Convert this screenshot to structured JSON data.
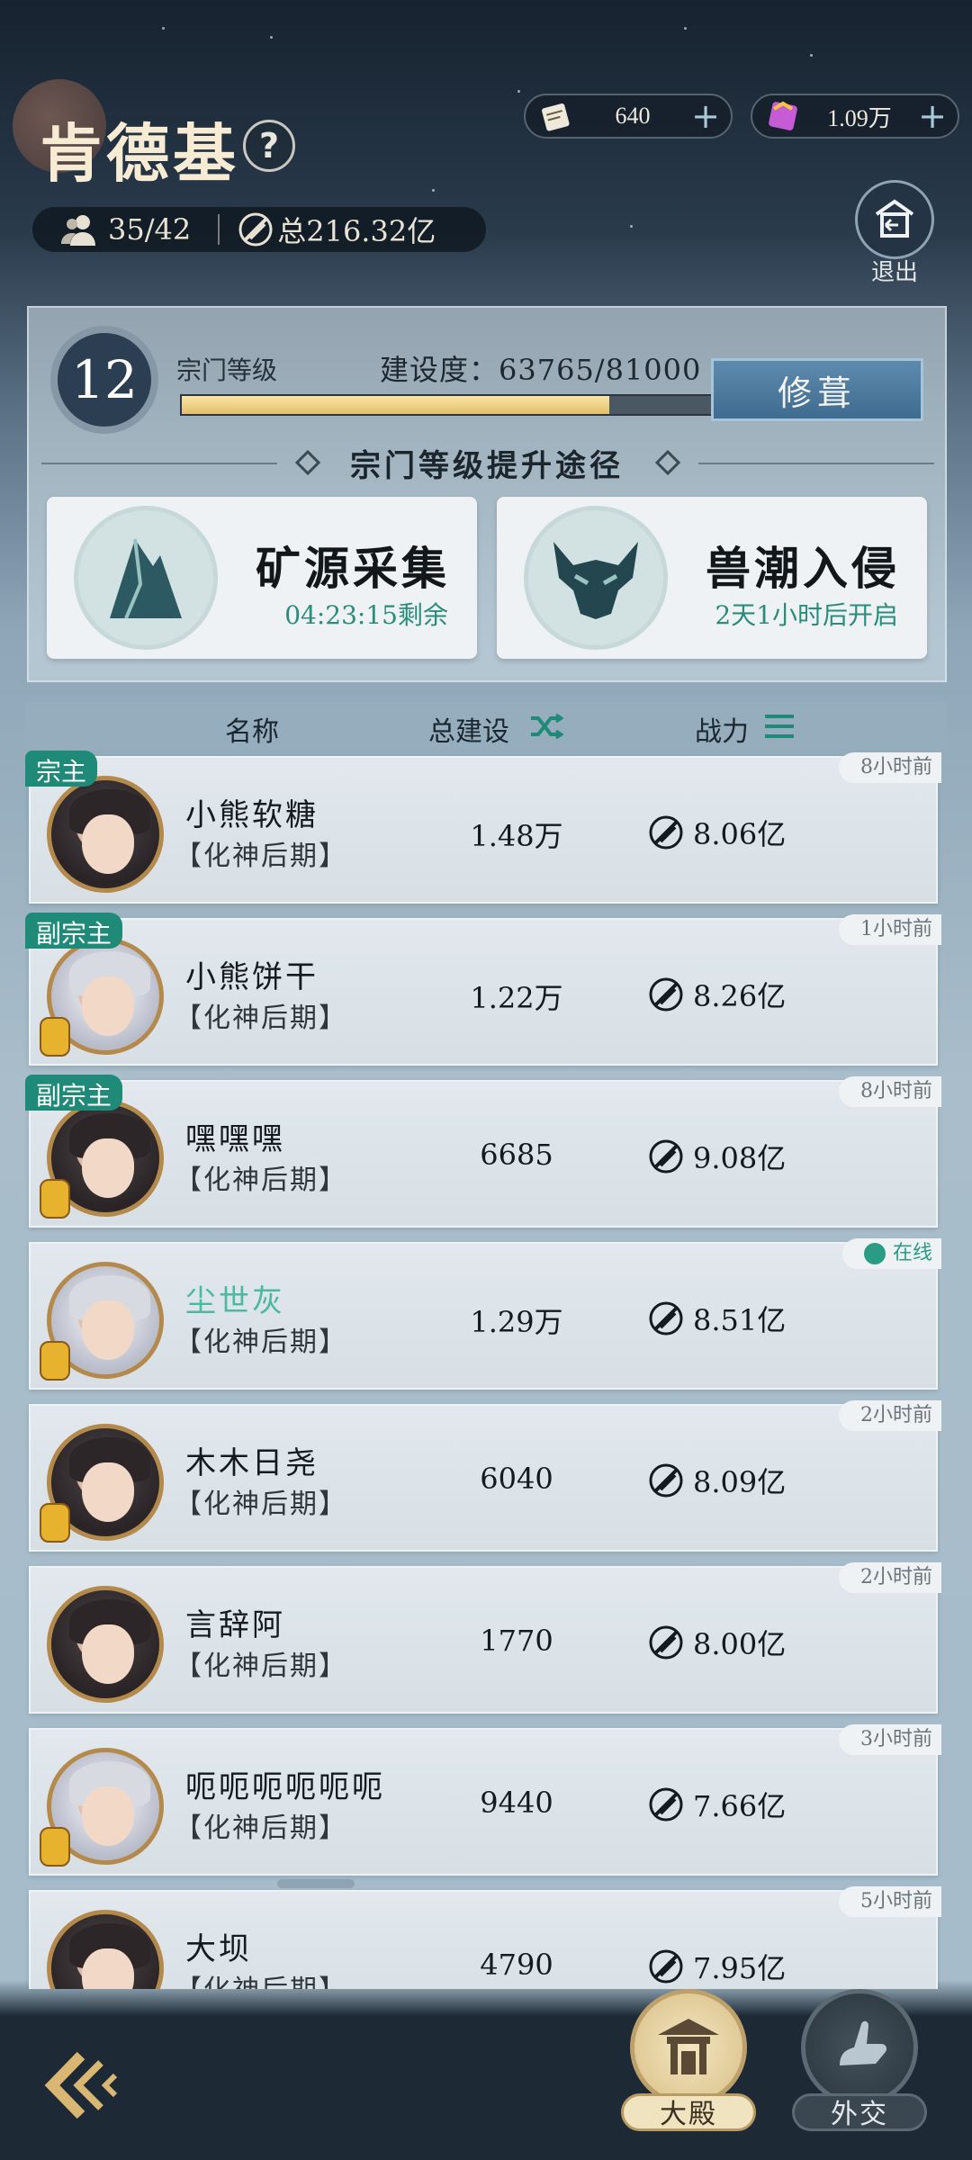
{
  "sect": {
    "name": "肯德基",
    "help": "?",
    "members": "35/42",
    "total_power": "总216.32亿"
  },
  "currency": [
    {
      "icon": "scroll-icon",
      "value": "640",
      "plus": "+"
    },
    {
      "icon": "gem-icon",
      "value": "1.09万",
      "plus": "+"
    }
  ],
  "exit": {
    "label": "退出"
  },
  "level": {
    "value": "12",
    "label": "宗门等级",
    "construction_label": "建设度：63765/81000",
    "construction_progress": 0.787,
    "repair_label": "修葺",
    "path_title": "宗门等级提升途径"
  },
  "activities": [
    {
      "title": "矿源采集",
      "status": "04:23:15剩余",
      "icon": "mountain-icon"
    },
    {
      "title": "兽潮入侵",
      "status": "2天1小时后开启",
      "icon": "demon-mask-icon"
    }
  ],
  "table": {
    "col_name": "名称",
    "col_build": "总建设",
    "col_power": "战力"
  },
  "members": [
    {
      "role": "宗主",
      "last_seen": "8小时前",
      "name": "小熊软糖",
      "realm": "【化神后期】",
      "build": "1.48万",
      "power": "8.06亿"
    },
    {
      "role": "副宗主",
      "last_seen": "1小时前",
      "name": "小熊饼干",
      "realm": "【化神后期】",
      "build": "1.22万",
      "power": "8.26亿"
    },
    {
      "role": "副宗主",
      "last_seen": "8小时前",
      "name": "嘿嘿嘿",
      "realm": "【化神后期】",
      "build": "6685",
      "power": "9.08亿"
    },
    {
      "role": "",
      "last_seen": "在线",
      "name": "尘世灰",
      "realm": "【化神后期】",
      "build": "1.29万",
      "power": "8.51亿"
    },
    {
      "role": "",
      "last_seen": "2小时前",
      "name": "木木日尧",
      "realm": "【化神后期】",
      "build": "6040",
      "power": "8.09亿"
    },
    {
      "role": "",
      "last_seen": "2小时前",
      "name": "言辞阿",
      "realm": "【化神后期】",
      "build": "1770",
      "power": "8.00亿"
    },
    {
      "role": "",
      "last_seen": "3小时前",
      "name": "呃呃呃呃呃呃",
      "realm": "【化神后期】",
      "build": "9440",
      "power": "7.66亿"
    },
    {
      "role": "",
      "last_seen": "5小时前",
      "name": "大坝",
      "realm": "【化神后期】",
      "build": "4790",
      "power": "7.95亿"
    }
  ],
  "nav": {
    "hall": "大殿",
    "diplomacy": "外交"
  }
}
